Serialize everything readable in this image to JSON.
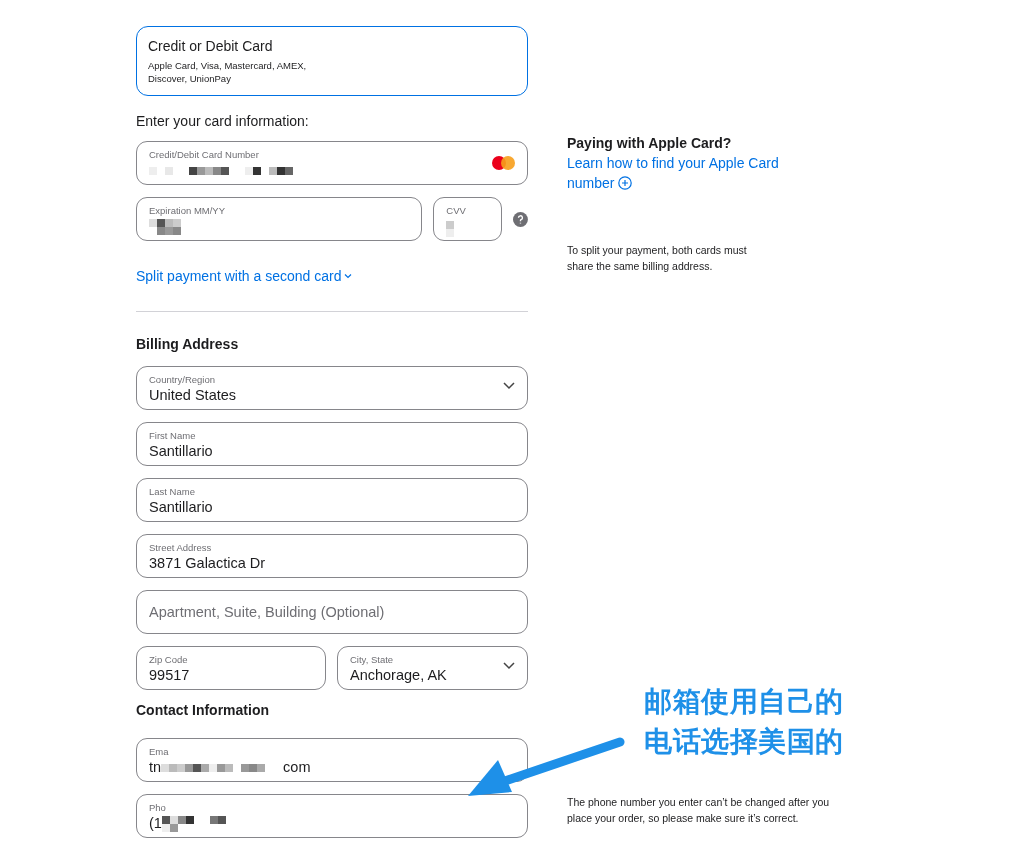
{
  "payment_option": {
    "title": "Credit or Debit Card",
    "subtitle_lines": [
      "Apple Card, Visa, Mastercard, AMEX,",
      "Discover, UnionPay"
    ],
    "selected": true
  },
  "card_prompt": "Enter your card information:",
  "card_number": {
    "label": "Credit/Debit Card Number"
  },
  "expiration": {
    "label": "Expiration MM/YY"
  },
  "cvv": {
    "label": "CVV"
  },
  "apple_card_note": {
    "title": "Paying with Apple Card?",
    "link": "Learn how to find your Apple Card number"
  },
  "split_link": "Split payment with a second card",
  "split_note": "To split your payment, both cards must share the same billing address.",
  "billing_heading": "Billing Address",
  "billing_fields": [
    {
      "kind": "select",
      "label": "Country/Region",
      "value": "United States"
    },
    {
      "kind": "input",
      "label": "First Name",
      "value": "Santillario"
    },
    {
      "kind": "input",
      "label": "Last Name",
      "value": "Santillario"
    },
    {
      "kind": "input",
      "label": "Street Address",
      "value": "3871 Galactica Dr"
    },
    {
      "kind": "empty",
      "placeholder": "Apartment, Suite, Building (Optional)"
    }
  ],
  "zip": {
    "label": "Zip Code",
    "value": "99517"
  },
  "city": {
    "label": "City, State",
    "value": "Anchorage, AK"
  },
  "contact_heading": "Contact Information",
  "email": {
    "label": "Ema",
    "value_start": "tn",
    "value_end": "com"
  },
  "phone": {
    "label": "Pho",
    "value_start": "(1"
  },
  "phone_note": "The phone number you enter can’t be changed after you place your order, so please make sure it’s correct.",
  "annotation": {
    "lines": [
      "邮箱使用自己的",
      "电话选择美国的"
    ]
  }
}
